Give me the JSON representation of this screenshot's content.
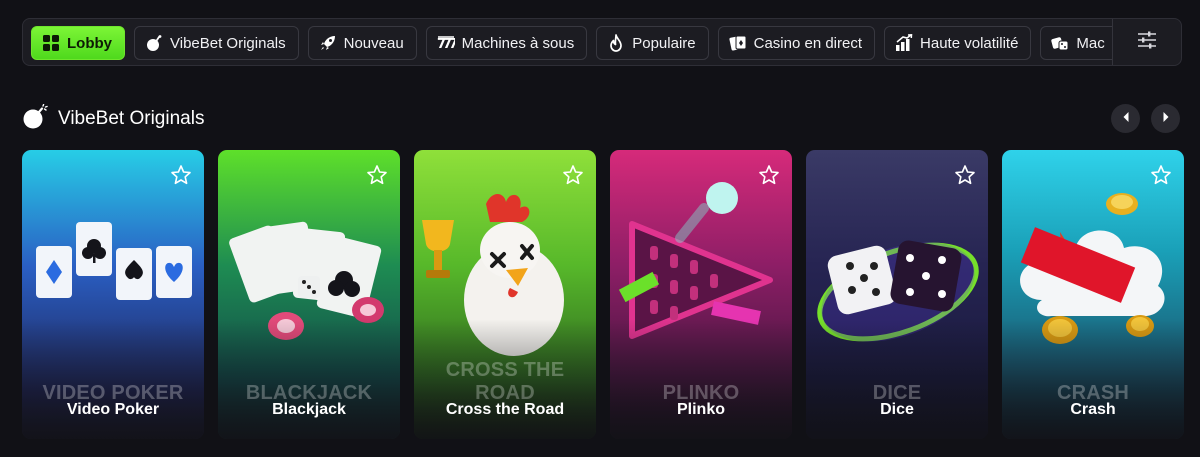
{
  "categories": [
    {
      "label": "Lobby",
      "icon": "grid-icon",
      "active": true
    },
    {
      "label": "VibeBet Originals",
      "icon": "bomb-icon",
      "active": false
    },
    {
      "label": "Nouveau",
      "icon": "rocket-icon",
      "active": false
    },
    {
      "label": "Machines à sous",
      "icon": "slot-machine-icon",
      "active": false
    },
    {
      "label": "Populaire",
      "icon": "flame-icon",
      "active": false
    },
    {
      "label": "Casino en direct",
      "icon": "cards-icon",
      "active": false
    },
    {
      "label": "Haute volatilité",
      "icon": "chart-up-icon",
      "active": false
    },
    {
      "label": "Mac",
      "icon": "dice-icon",
      "active": false
    }
  ],
  "section": {
    "title": "VibeBet Originals",
    "icon": "bomb-icon"
  },
  "games": [
    {
      "big": "VIDEO POKER",
      "name": "Video Poker",
      "theme": "cyan-blue"
    },
    {
      "big": "BLACKJACK",
      "name": "Blackjack",
      "theme": "green"
    },
    {
      "big": "CROSS THE ROAD",
      "name": "Cross the Road",
      "theme": "lime"
    },
    {
      "big": "PLINKO",
      "name": "Plinko",
      "theme": "magenta"
    },
    {
      "big": "DICE",
      "name": "Dice",
      "theme": "indigo"
    },
    {
      "big": "CRASH",
      "name": "Crash",
      "theme": "cyan"
    }
  ],
  "colors": {
    "accent": "#5ee02a",
    "background": "#111116",
    "bar": "#1c1c22"
  }
}
